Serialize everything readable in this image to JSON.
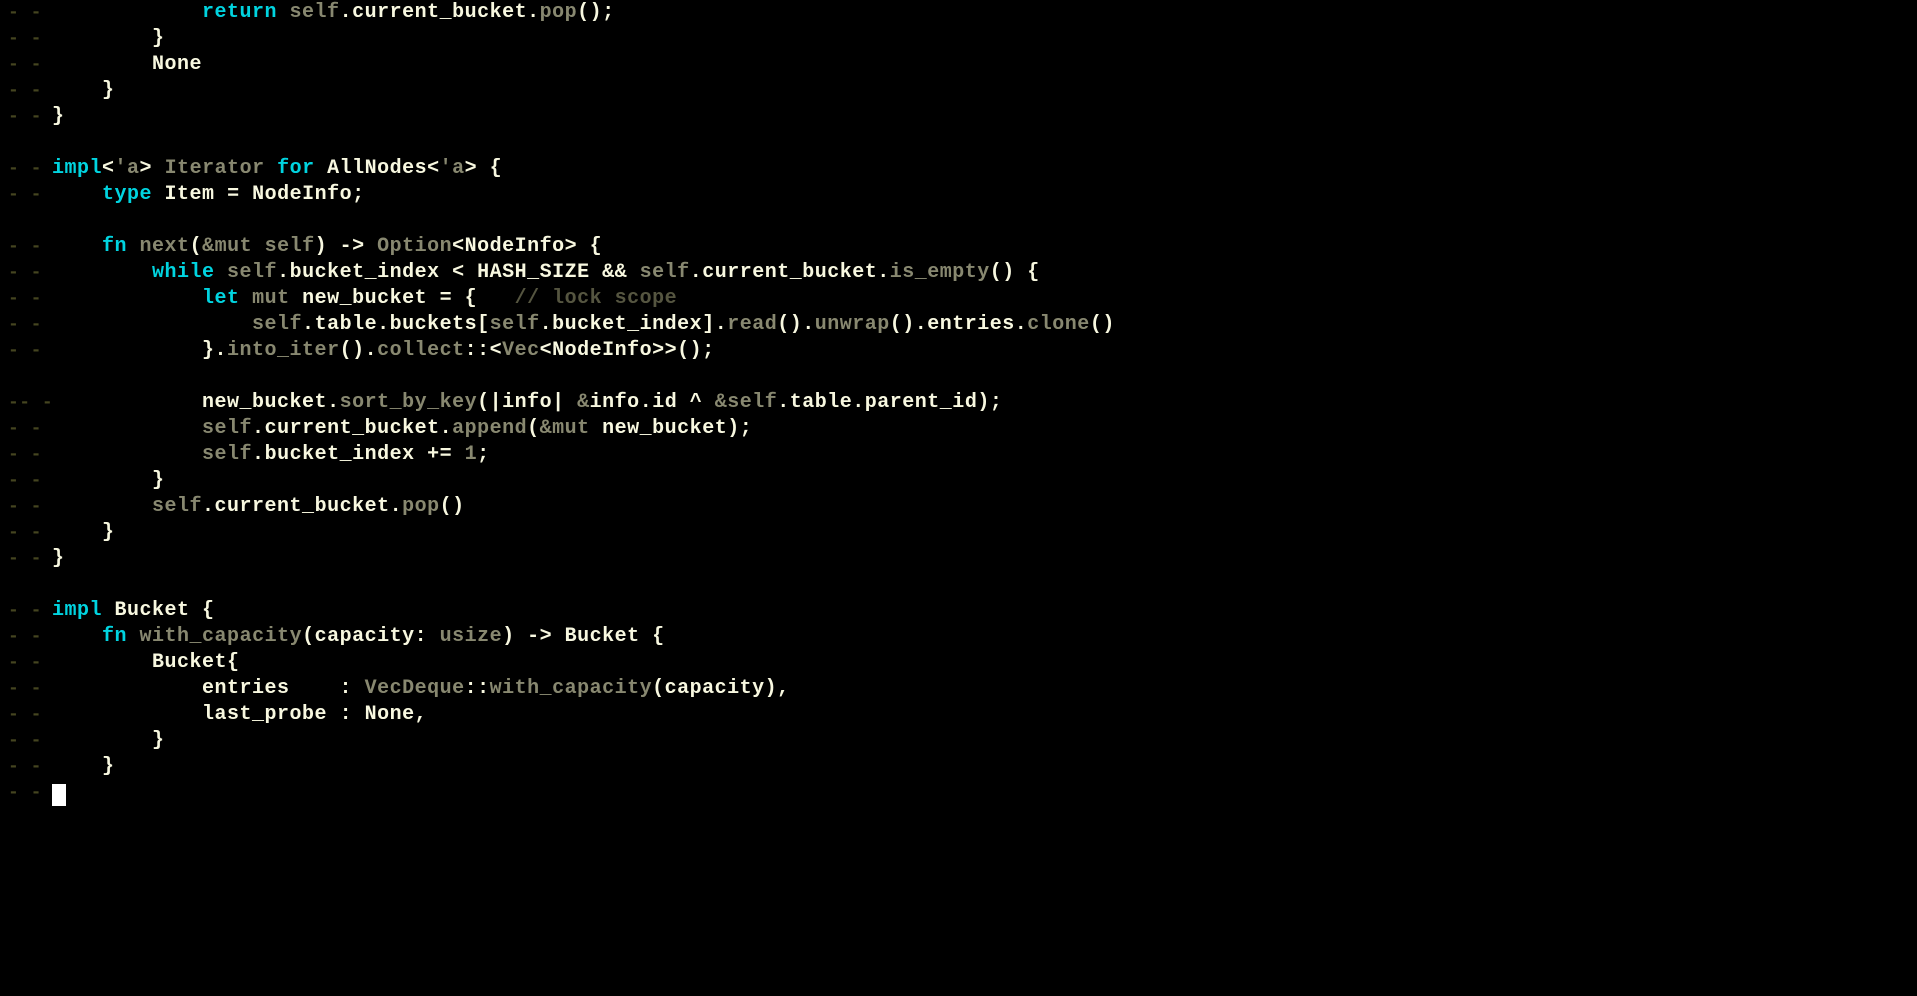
{
  "gutter": {
    "marks": [
      "- -",
      "- -",
      "- -",
      "- -",
      "- -",
      "",
      "- -",
      "- -",
      "",
      "- -",
      "- -",
      "- -",
      "- -",
      "- -",
      "",
      "-- -",
      "- -",
      "- -",
      "- -",
      "- -",
      "- -",
      "- -",
      "",
      "- -",
      "- -",
      "- -",
      "- -",
      "- -",
      "- -",
      "- -",
      "- -"
    ]
  },
  "code": {
    "lines": [
      {
        "indent": "            ",
        "tokens": [
          {
            "c": "kw",
            "t": "return"
          },
          {
            "c": "dim",
            "t": " self"
          },
          {
            "c": "punct",
            "t": "."
          },
          {
            "c": "ident",
            "t": "current_bucket"
          },
          {
            "c": "punct",
            "t": "."
          },
          {
            "c": "dim",
            "t": "pop"
          },
          {
            "c": "punct",
            "t": "();"
          }
        ]
      },
      {
        "indent": "        ",
        "tokens": [
          {
            "c": "punct",
            "t": "}"
          }
        ]
      },
      {
        "indent": "        ",
        "tokens": [
          {
            "c": "none",
            "t": "None"
          }
        ]
      },
      {
        "indent": "    ",
        "tokens": [
          {
            "c": "punct",
            "t": "}"
          }
        ]
      },
      {
        "indent": "",
        "tokens": [
          {
            "c": "punct",
            "t": "}"
          }
        ]
      },
      {
        "indent": "",
        "tokens": []
      },
      {
        "indent": "",
        "tokens": [
          {
            "c": "kw",
            "t": "impl"
          },
          {
            "c": "punct",
            "t": "<"
          },
          {
            "c": "dim",
            "t": "'a"
          },
          {
            "c": "punct",
            "t": "> "
          },
          {
            "c": "dim",
            "t": "Iterator"
          },
          {
            "c": "punct",
            "t": " "
          },
          {
            "c": "kw",
            "t": "for"
          },
          {
            "c": "punct",
            "t": " "
          },
          {
            "c": "ident",
            "t": "AllNodes"
          },
          {
            "c": "punct",
            "t": "<"
          },
          {
            "c": "dim",
            "t": "'a"
          },
          {
            "c": "punct",
            "t": "> {"
          }
        ]
      },
      {
        "indent": "    ",
        "tokens": [
          {
            "c": "kw",
            "t": "type"
          },
          {
            "c": "punct",
            "t": " "
          },
          {
            "c": "ident",
            "t": "Item"
          },
          {
            "c": "punct",
            "t": " = "
          },
          {
            "c": "type",
            "t": "NodeInfo"
          },
          {
            "c": "punct",
            "t": ";"
          }
        ]
      },
      {
        "indent": "",
        "tokens": []
      },
      {
        "indent": "    ",
        "tokens": [
          {
            "c": "fn",
            "t": "fn"
          },
          {
            "c": "punct",
            "t": " "
          },
          {
            "c": "dim",
            "t": "next"
          },
          {
            "c": "punct",
            "t": "("
          },
          {
            "c": "dim",
            "t": "&mut self"
          },
          {
            "c": "punct",
            "t": ") -> "
          },
          {
            "c": "dim",
            "t": "Option"
          },
          {
            "c": "punct",
            "t": "<"
          },
          {
            "c": "type",
            "t": "NodeInfo"
          },
          {
            "c": "punct",
            "t": "> {"
          }
        ]
      },
      {
        "indent": "        ",
        "tokens": [
          {
            "c": "kw",
            "t": "while"
          },
          {
            "c": "punct",
            "t": " "
          },
          {
            "c": "dim",
            "t": "self"
          },
          {
            "c": "punct",
            "t": "."
          },
          {
            "c": "ident",
            "t": "bucket_index"
          },
          {
            "c": "punct",
            "t": " < "
          },
          {
            "c": "ident",
            "t": "HASH_SIZE"
          },
          {
            "c": "punct",
            "t": " && "
          },
          {
            "c": "dim",
            "t": "self"
          },
          {
            "c": "punct",
            "t": "."
          },
          {
            "c": "ident",
            "t": "current_bucket"
          },
          {
            "c": "punct",
            "t": "."
          },
          {
            "c": "dim",
            "t": "is_empty"
          },
          {
            "c": "punct",
            "t": "() {"
          }
        ]
      },
      {
        "indent": "            ",
        "tokens": [
          {
            "c": "kw",
            "t": "let"
          },
          {
            "c": "punct",
            "t": " "
          },
          {
            "c": "dim",
            "t": "mut"
          },
          {
            "c": "punct",
            "t": " "
          },
          {
            "c": "ident",
            "t": "new_bucket"
          },
          {
            "c": "punct",
            "t": " = {   "
          },
          {
            "c": "comment",
            "t": "// lock scope"
          }
        ]
      },
      {
        "indent": "                ",
        "tokens": [
          {
            "c": "dim",
            "t": "self"
          },
          {
            "c": "punct",
            "t": "."
          },
          {
            "c": "ident",
            "t": "table"
          },
          {
            "c": "punct",
            "t": "."
          },
          {
            "c": "ident",
            "t": "buckets"
          },
          {
            "c": "punct",
            "t": "["
          },
          {
            "c": "dim",
            "t": "self"
          },
          {
            "c": "punct",
            "t": "."
          },
          {
            "c": "ident",
            "t": "bucket_index"
          },
          {
            "c": "punct",
            "t": "]."
          },
          {
            "c": "dim",
            "t": "read"
          },
          {
            "c": "punct",
            "t": "()."
          },
          {
            "c": "dim",
            "t": "unwrap"
          },
          {
            "c": "punct",
            "t": "()."
          },
          {
            "c": "ident",
            "t": "entries"
          },
          {
            "c": "punct",
            "t": "."
          },
          {
            "c": "dim",
            "t": "clone"
          },
          {
            "c": "punct",
            "t": "()"
          }
        ]
      },
      {
        "indent": "            ",
        "tokens": [
          {
            "c": "punct",
            "t": "}."
          },
          {
            "c": "dim",
            "t": "into_iter"
          },
          {
            "c": "punct",
            "t": "()."
          },
          {
            "c": "dim",
            "t": "collect"
          },
          {
            "c": "punct",
            "t": "::<"
          },
          {
            "c": "dim",
            "t": "Vec"
          },
          {
            "c": "punct",
            "t": "<"
          },
          {
            "c": "type",
            "t": "NodeInfo"
          },
          {
            "c": "punct",
            "t": ">>();"
          }
        ]
      },
      {
        "indent": "",
        "tokens": []
      },
      {
        "indent": "            ",
        "tokens": [
          {
            "c": "ident",
            "t": "new_bucket"
          },
          {
            "c": "punct",
            "t": "."
          },
          {
            "c": "dim",
            "t": "sort_by_key"
          },
          {
            "c": "punct",
            "t": "(|"
          },
          {
            "c": "ident",
            "t": "info"
          },
          {
            "c": "punct",
            "t": "| "
          },
          {
            "c": "dim",
            "t": "&"
          },
          {
            "c": "ident",
            "t": "info"
          },
          {
            "c": "punct",
            "t": "."
          },
          {
            "c": "ident",
            "t": "id"
          },
          {
            "c": "punct",
            "t": " ^ "
          },
          {
            "c": "dim",
            "t": "&self"
          },
          {
            "c": "punct",
            "t": "."
          },
          {
            "c": "ident",
            "t": "table"
          },
          {
            "c": "punct",
            "t": "."
          },
          {
            "c": "ident",
            "t": "parent_id"
          },
          {
            "c": "punct",
            "t": ");"
          }
        ]
      },
      {
        "indent": "            ",
        "tokens": [
          {
            "c": "dim",
            "t": "self"
          },
          {
            "c": "punct",
            "t": "."
          },
          {
            "c": "ident",
            "t": "current_bucket"
          },
          {
            "c": "punct",
            "t": "."
          },
          {
            "c": "dim",
            "t": "append"
          },
          {
            "c": "punct",
            "t": "("
          },
          {
            "c": "dim",
            "t": "&mut"
          },
          {
            "c": "punct",
            "t": " "
          },
          {
            "c": "ident",
            "t": "new_bucket"
          },
          {
            "c": "punct",
            "t": ");"
          }
        ]
      },
      {
        "indent": "            ",
        "tokens": [
          {
            "c": "dim",
            "t": "self"
          },
          {
            "c": "punct",
            "t": "."
          },
          {
            "c": "ident",
            "t": "bucket_index"
          },
          {
            "c": "punct",
            "t": " += "
          },
          {
            "c": "num",
            "t": "1"
          },
          {
            "c": "punct",
            "t": ";"
          }
        ]
      },
      {
        "indent": "        ",
        "tokens": [
          {
            "c": "punct",
            "t": "}"
          }
        ]
      },
      {
        "indent": "        ",
        "tokens": [
          {
            "c": "dim",
            "t": "self"
          },
          {
            "c": "punct",
            "t": "."
          },
          {
            "c": "ident",
            "t": "current_bucket"
          },
          {
            "c": "punct",
            "t": "."
          },
          {
            "c": "dim",
            "t": "pop"
          },
          {
            "c": "punct",
            "t": "()"
          }
        ]
      },
      {
        "indent": "    ",
        "tokens": [
          {
            "c": "punct",
            "t": "}"
          }
        ]
      },
      {
        "indent": "",
        "tokens": [
          {
            "c": "punct",
            "t": "}"
          }
        ]
      },
      {
        "indent": "",
        "tokens": []
      },
      {
        "indent": "",
        "tokens": [
          {
            "c": "kw",
            "t": "impl"
          },
          {
            "c": "punct",
            "t": " "
          },
          {
            "c": "ident",
            "t": "Bucket"
          },
          {
            "c": "punct",
            "t": " {"
          }
        ]
      },
      {
        "indent": "    ",
        "tokens": [
          {
            "c": "fn",
            "t": "fn"
          },
          {
            "c": "punct",
            "t": " "
          },
          {
            "c": "dim",
            "t": "with_capacity"
          },
          {
            "c": "punct",
            "t": "("
          },
          {
            "c": "ident",
            "t": "capacity"
          },
          {
            "c": "punct",
            "t": ": "
          },
          {
            "c": "dim",
            "t": "usize"
          },
          {
            "c": "punct",
            "t": ") -> "
          },
          {
            "c": "ident",
            "t": "Bucket"
          },
          {
            "c": "punct",
            "t": " {"
          }
        ]
      },
      {
        "indent": "        ",
        "tokens": [
          {
            "c": "ident",
            "t": "Bucket"
          },
          {
            "c": "punct",
            "t": "{"
          }
        ]
      },
      {
        "indent": "            ",
        "tokens": [
          {
            "c": "ident",
            "t": "entries"
          },
          {
            "c": "punct",
            "t": "    : "
          },
          {
            "c": "dim",
            "t": "VecDeque"
          },
          {
            "c": "punct",
            "t": "::"
          },
          {
            "c": "dim",
            "t": "with_capacity"
          },
          {
            "c": "punct",
            "t": "("
          },
          {
            "c": "ident",
            "t": "capacity"
          },
          {
            "c": "punct",
            "t": "),"
          }
        ]
      },
      {
        "indent": "            ",
        "tokens": [
          {
            "c": "ident",
            "t": "last_probe"
          },
          {
            "c": "punct",
            "t": " : "
          },
          {
            "c": "none",
            "t": "None"
          },
          {
            "c": "punct",
            "t": ","
          }
        ]
      },
      {
        "indent": "        ",
        "tokens": [
          {
            "c": "punct",
            "t": "}"
          }
        ]
      },
      {
        "indent": "    ",
        "tokens": [
          {
            "c": "punct",
            "t": "}"
          }
        ]
      },
      {
        "indent": "",
        "tokens": []
      }
    ]
  }
}
